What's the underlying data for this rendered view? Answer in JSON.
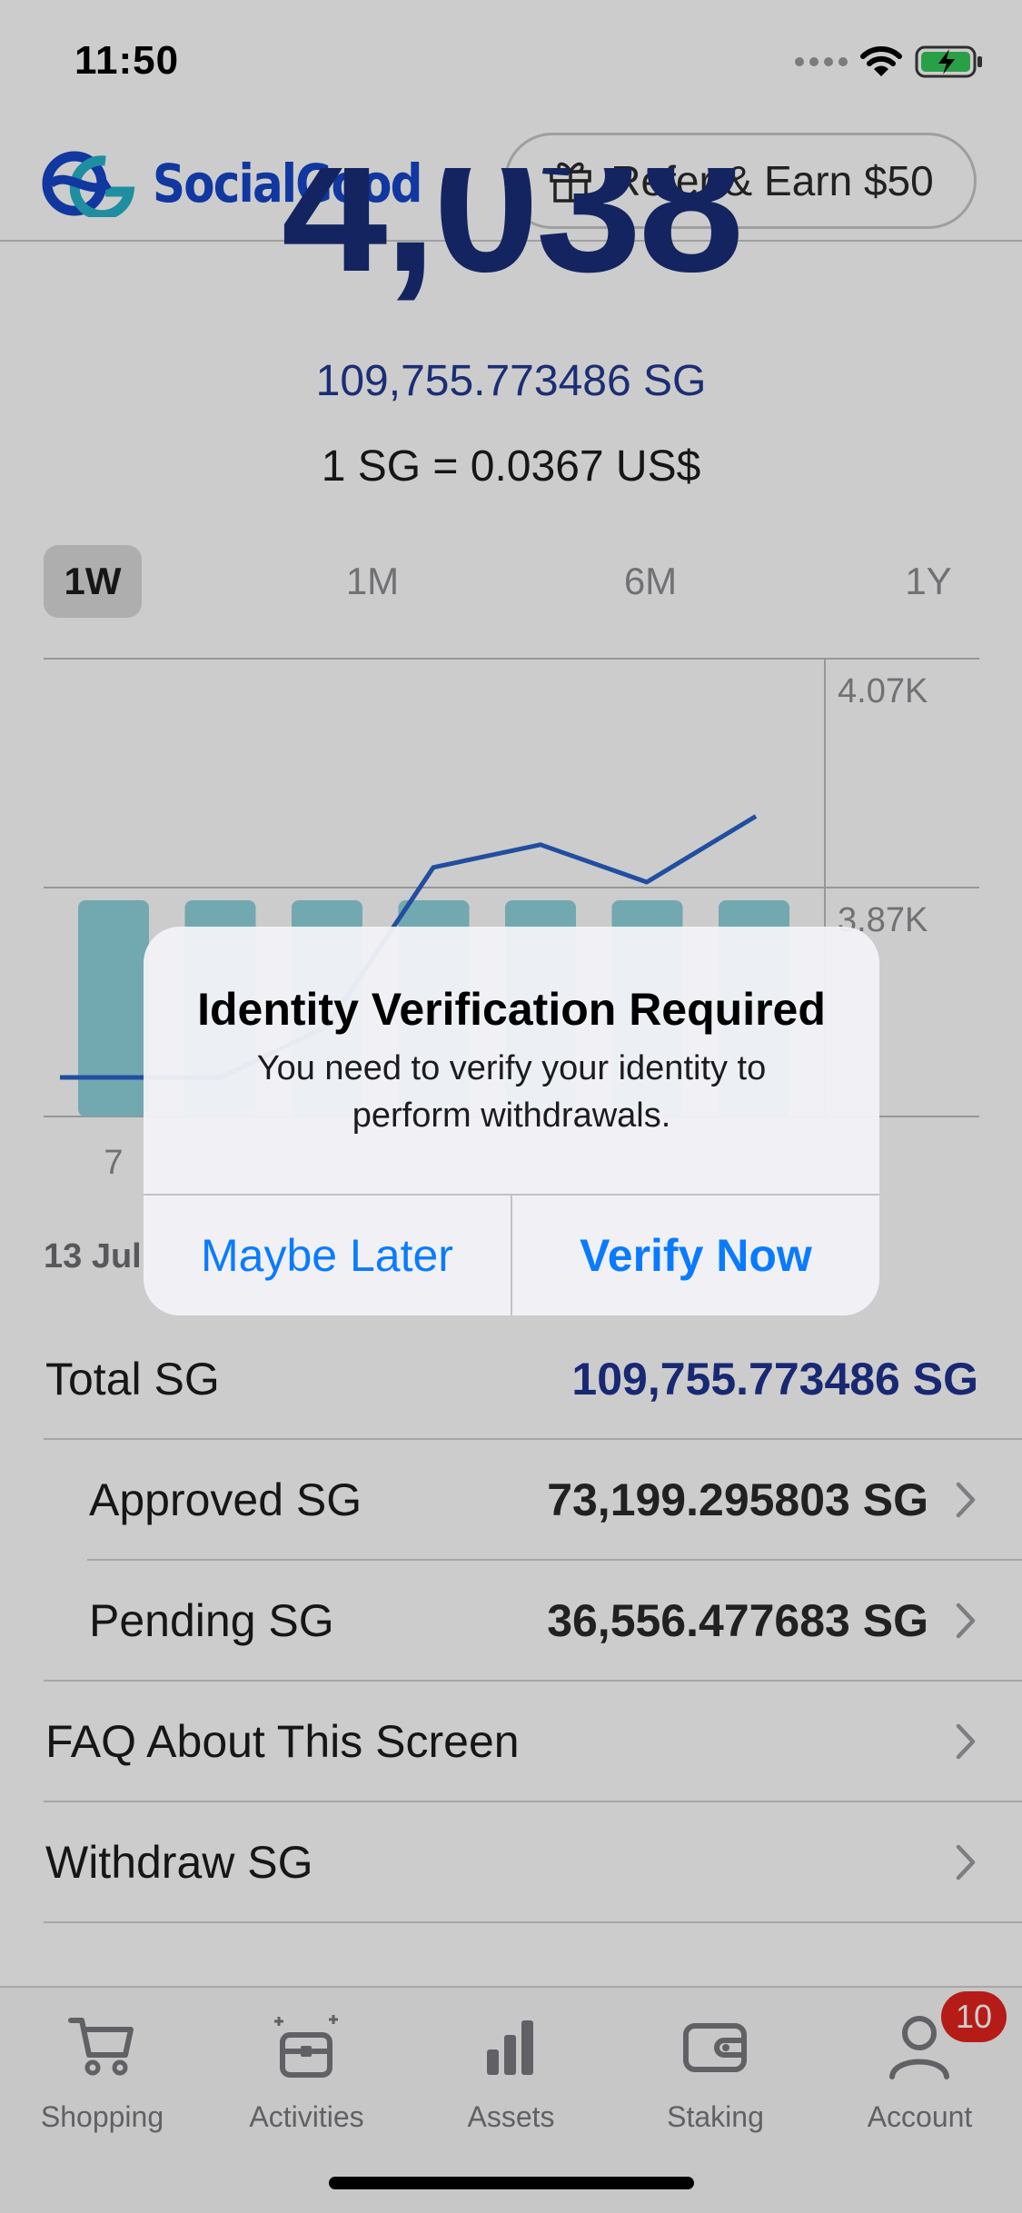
{
  "status_bar": {
    "time": "11:50"
  },
  "header": {
    "brand": "SocialGood",
    "refer_label": "Refer & Earn $50"
  },
  "balance": {
    "usd": "4,038",
    "sg": "109,755.773486 SG",
    "rate": "1 SG = 0.0367 US$"
  },
  "periods": [
    "1W",
    "1M",
    "6M",
    "1Y"
  ],
  "active_period": "1W",
  "chart_data": {
    "type": "bar+line",
    "y_ticks": [
      "4.07K",
      "3.87K"
    ],
    "x_tick_visible": "7",
    "date_label": "13 Jul",
    "bar_levels": [
      1,
      1,
      1,
      1,
      1,
      1,
      1
    ],
    "line_values": [
      0.0,
      0.0,
      0.45,
      1.85,
      2.05,
      1.72,
      2.3
    ]
  },
  "list": {
    "total_label": "Total SG",
    "total_value": "109,755.773486 SG",
    "approved_label": "Approved SG",
    "approved_value": "73,199.295803 SG",
    "pending_label": "Pending SG",
    "pending_value": "36,556.477683 SG",
    "faq_label": "FAQ About This Screen",
    "withdraw_label": "Withdraw SG"
  },
  "tabs": [
    {
      "label": "Shopping",
      "icon": "cart-icon"
    },
    {
      "label": "Activities",
      "icon": "gift-box-icon"
    },
    {
      "label": "Assets",
      "icon": "bar-chart-icon"
    },
    {
      "label": "Staking",
      "icon": "wallet-icon"
    },
    {
      "label": "Account",
      "icon": "person-icon"
    }
  ],
  "account_badge": "10",
  "alert": {
    "title": "Identity Verification Required",
    "message": "You need to verify your identity to perform withdrawals.",
    "cancel_label": "Maybe Later",
    "confirm_label": "Verify Now"
  },
  "colors": {
    "brand_blue": "#1645c9",
    "balance_navy": "#1a2e7a",
    "bar_teal": "#8fd3dc",
    "line_blue": "#2a62c8",
    "ios_blue": "#0a7bff",
    "badge_red": "#e3231d"
  }
}
